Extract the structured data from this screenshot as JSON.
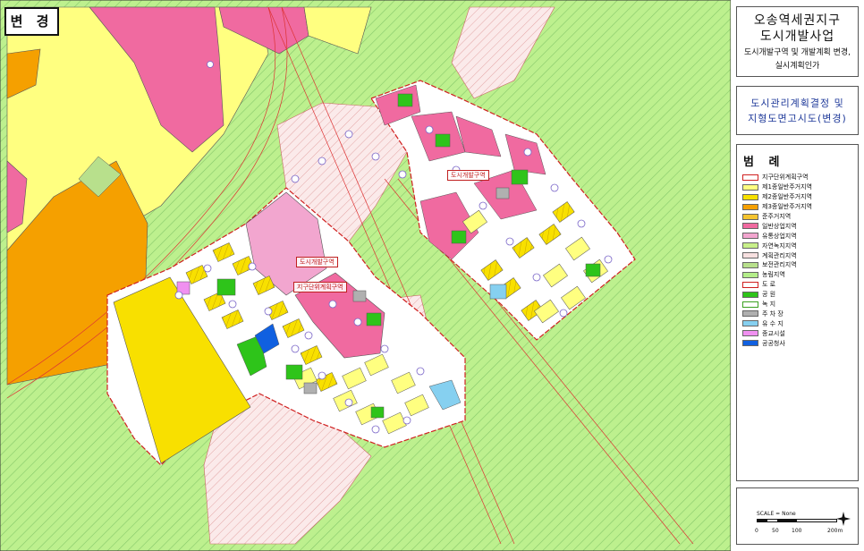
{
  "badge": "변 경",
  "title": {
    "line1": "오송역세권지구",
    "line2": "도시개발사업",
    "line3": "도시개발구역 및 개발계획 변경,",
    "line4": "실시계획인가"
  },
  "subtitle": {
    "line1": "도시관리계획결정 및",
    "line2": "지형도면고시도(변경)"
  },
  "legend": {
    "title": "범 례",
    "items": [
      {
        "label": "지구단위계획구역",
        "color": "#ffffff",
        "border": "#d02020"
      },
      {
        "label": "제1종일반주거지역",
        "color": "#ffff80",
        "border": "#666666"
      },
      {
        "label": "제2종일반주거지역",
        "color": "#f8e000",
        "border": "#666666"
      },
      {
        "label": "제3종일반주거지역",
        "color": "#f5a000",
        "border": "#666666"
      },
      {
        "label": "준주거지역",
        "color": "#f4c430",
        "border": "#666666"
      },
      {
        "label": "일반상업지역",
        "color": "#f06aa0",
        "border": "#666666"
      },
      {
        "label": "유통상업지역",
        "color": "#f2a6cf",
        "border": "#666666"
      },
      {
        "label": "자연녹지지역",
        "color": "#c8f08a",
        "border": "#666666"
      },
      {
        "label": "계획관리지역",
        "color": "#f7e0e0",
        "border": "#666666"
      },
      {
        "label": "보전관리지역",
        "color": "#b8e08c",
        "border": "#666666"
      },
      {
        "label": "농림지역",
        "color": "#b4ee8a",
        "border": "#666666"
      },
      {
        "label": "도 로",
        "color": "#ffffff",
        "border": "#d02020"
      },
      {
        "label": "공 원",
        "color": "#2ec41a",
        "border": "#666666"
      },
      {
        "label": "녹 지",
        "color": "#ffffff",
        "border": "#3aa020"
      },
      {
        "label": "주 차 장",
        "color": "#b0b0b0",
        "border": "#666666"
      },
      {
        "label": "유 수 지",
        "color": "#86d0f0",
        "border": "#666666"
      },
      {
        "label": "종교시설",
        "color": "#f090f0",
        "border": "#666666"
      },
      {
        "label": "공공청사",
        "color": "#1060e0",
        "border": "#666666"
      }
    ]
  },
  "scale": {
    "label": "SCALE = None",
    "ticks": [
      "0",
      "50",
      "100",
      "200m"
    ]
  },
  "map_labels": {
    "district": "도시개발구역",
    "unit_plan": "지구단위계획구역",
    "zone_north": "도시개발구역"
  }
}
